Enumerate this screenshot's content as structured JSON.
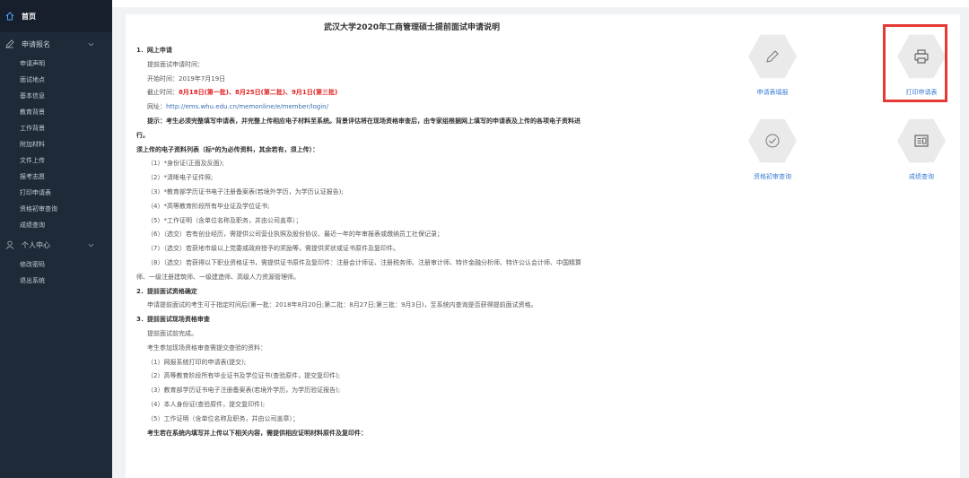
{
  "sidebar": {
    "home": "首页",
    "apply_section": "申请报名",
    "apply_items": [
      "申请声明",
      "面试地点",
      "基本信息",
      "教育背景",
      "工作背景",
      "附加材料",
      "文件上传",
      "报考志愿",
      "打印申请表",
      "资格初审查询",
      "成绩查询"
    ],
    "personal_section": "个人中心",
    "personal_items": [
      "修改密码",
      "退出系统"
    ]
  },
  "doc": {
    "title": "武汉大学2020年工商管理硕士提前面试申请说明",
    "s1": "1．网上申请",
    "s1_l1": "提前面试申请时间：",
    "s1_l2": "开始时间：2019年7月19日",
    "s1_l3_pre": "截止时间：",
    "s1_l3_red": "8月18日(第一批)、8月25日(第二批)、9月1日(第三批)",
    "s1_l4_pre": "网址：",
    "s1_l4_link": "http://ems.whu.edu.cn/memonline/e/member/login/",
    "s1_l5": "提示：考生必须完整填写申请表，并完整上传相应电子材料至系统。背景评估将在现场资格审查后，由专家组根据网上填写的申请表及上传的各项电子资料进",
    "s1_l5b": "行。",
    "s1_l6": "须上传的电子资料列表（标*的为必传资料，其余若有，须上传）：",
    "s1_items": [
      "（1）*身份证(正面及反面);",
      "（2）*清晰电子证件照;",
      "（3）*教育部学历证书电子注册备案表(若境外学历，为学历认证报告);",
      "（4）*高等教育阶段所有毕业证及学位证书;",
      "（5）*工作证明（含单位名称及职务，并由公司盖章）；",
      "（6）（选交）若有创业经历，需提供公司营业执照及股份协议、最近一年的年审报表或缴纳员工社保记录；",
      "（7）（选交）若获地市级以上党委或政府授予的奖励等，需提供奖状或证书原件及复印件。",
      "（8）（选交）若获得以下职业资格证书，需提供证书原件及复印件：注册会计师证、注册税务师、注册审计师、特许金融分析师、特许公认会计师、中国精算"
    ],
    "s1_items_cont": "师、一级注册建筑师、一级建造师、高级人力资源管理师。",
    "s2": "2．提前面试资格确定",
    "s2_l1": "申请提前面试的考生可于指定时间后(第一批：2018年8月20日;第二批：8月27日;第三批：9月3日)，至系统内查询是否获得提前面试资格。",
    "s3": "3．提前面试现场资格审查",
    "s3_l1": "提前面试前完成。",
    "s3_l2": "考生参加现场资格审查需提交查验的资料：",
    "s3_items": [
      "（1）网报系统打印的申请表(提交);",
      "（2）高等教育阶段所有毕业证书及学位证书(查验原件，提交复印件);",
      "（3）教育部学历证书电子注册备案表(若境外学历，为学历验证报告);",
      "（4）本人身份证(查验原件，提交复印件);",
      "（5）工作证明（含单位名称及职务，并由公司盖章）；"
    ],
    "s3_l3": "考生若在系统内填写并上传以下相关内容，需提供相应证明材料原件及复印件："
  },
  "cards": {
    "apply_form": "申请表填报",
    "print_form": "打印申请表",
    "prelim_check": "资格初审查询",
    "score_query": "成绩查询"
  },
  "colors": {
    "sidebar_bg": "#1f2a38",
    "link": "#3a7bd5",
    "highlight": "#e53935",
    "deadline": "#e02020"
  }
}
